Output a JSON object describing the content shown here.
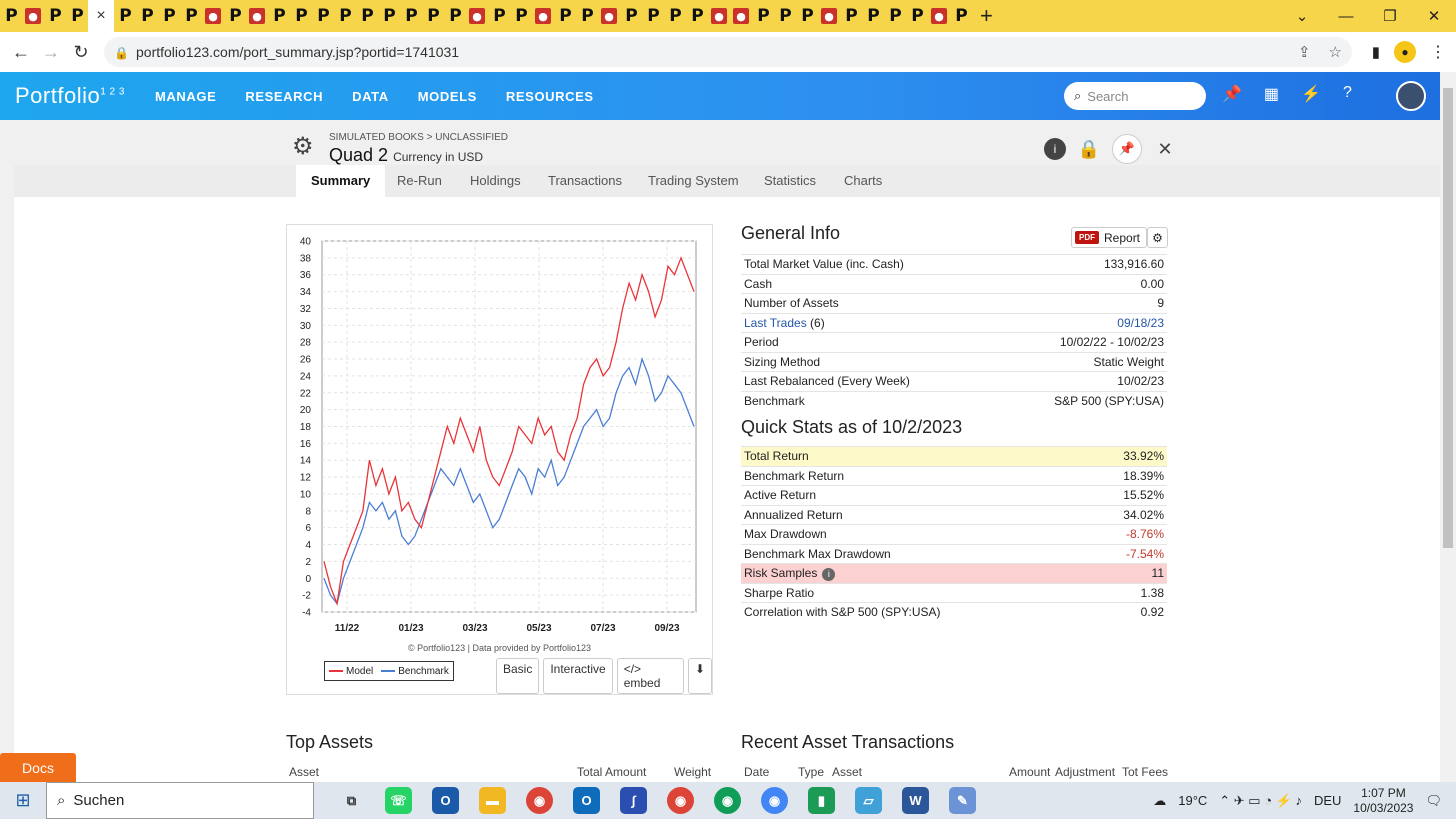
{
  "browser": {
    "active_tab_close": "×",
    "new_tab": "+",
    "url": "portfolio123.com/port_summary.jsp?portid=1741031"
  },
  "site": {
    "logo": "Portfolio",
    "logo_sup": "1 2 3",
    "nav": [
      "MANAGE",
      "RESEARCH",
      "DATA",
      "MODELS",
      "RESOURCES"
    ],
    "search_placeholder": "Search"
  },
  "portfolio": {
    "breadcrumb": "SIMULATED BOOKS > UNCLASSIFIED",
    "name": "Quad 2",
    "currency": "Currency in USD"
  },
  "subtabs": [
    "Summary",
    "Re-Run",
    "Holdings",
    "Transactions",
    "Trading System",
    "Statistics",
    "Charts"
  ],
  "general_info": {
    "title": "General Info",
    "report_pdf": "PDF",
    "report_label": "Report",
    "rows": [
      {
        "label": "Total Market Value (inc. Cash)",
        "value": "133,916.60"
      },
      {
        "label": "Cash",
        "value": "0.00"
      },
      {
        "label": "Number of Assets",
        "value": "9"
      },
      {
        "label": "Last Trades",
        "label_extra": " (6)",
        "value": "09/18/23",
        "link": true
      },
      {
        "label": "Period",
        "value": "10/02/22 - 10/02/23"
      },
      {
        "label": "Sizing Method",
        "value": "Static Weight"
      },
      {
        "label": "Last Rebalanced (Every Week)",
        "value": "10/02/23"
      },
      {
        "label": "Benchmark",
        "value": "S&P 500 (SPY:USA)"
      }
    ]
  },
  "quick_stats": {
    "title": "Quick Stats as of 10/2/2023",
    "rows": [
      {
        "label": "Total Return",
        "value": "33.92%",
        "hl": "y"
      },
      {
        "label": "Benchmark Return",
        "value": "18.39%"
      },
      {
        "label": "Active Return",
        "value": "15.52%"
      },
      {
        "label": "Annualized Return",
        "value": "34.02%"
      },
      {
        "label": "Max Drawdown",
        "value": "-8.76%",
        "neg": true
      },
      {
        "label": "Benchmark Max Drawdown",
        "value": "-7.54%",
        "neg": true
      },
      {
        "label": "Risk Samples",
        "value": "11",
        "hl": "r",
        "info": true
      },
      {
        "label": "Sharpe Ratio",
        "value": "1.38"
      },
      {
        "label": "Correlation with S&P 500 (SPY:USA)",
        "value": "0.92"
      }
    ]
  },
  "chart_data": {
    "type": "line",
    "x_ticks": [
      "11/22",
      "01/23",
      "03/23",
      "05/23",
      "07/23",
      "09/23"
    ],
    "ylim": [
      -4,
      40
    ],
    "y_ticks": [
      40,
      38,
      36,
      34,
      32,
      30,
      28,
      26,
      24,
      22,
      20,
      18,
      16,
      14,
      12,
      10,
      8,
      6,
      4,
      2,
      0,
      -2,
      -4
    ],
    "grid": true,
    "legend": "bottom-left",
    "series": [
      {
        "name": "Model",
        "color": "#e8343a",
        "values": [
          2,
          -1,
          -3,
          2,
          4,
          6,
          8,
          14,
          11,
          13,
          10,
          12,
          8,
          9,
          7,
          6,
          9,
          12,
          15,
          18,
          16,
          19,
          17,
          15,
          18,
          14,
          12,
          11,
          13,
          15,
          18,
          17,
          16,
          19,
          17,
          18,
          15,
          14,
          17,
          19,
          23,
          25,
          26,
          24,
          25,
          28,
          32,
          35,
          33,
          36,
          34,
          31,
          33,
          37,
          36,
          38,
          36,
          34
        ]
      },
      {
        "name": "Benchmark",
        "color": "#4a7ed3",
        "values": [
          0,
          -2,
          -3,
          0,
          2,
          4,
          6,
          9,
          8,
          9,
          7,
          8,
          5,
          4,
          5,
          7,
          9,
          11,
          13,
          12,
          11,
          13,
          11,
          9,
          10,
          8,
          6,
          7,
          9,
          11,
          13,
          12,
          10,
          13,
          12,
          14,
          11,
          12,
          14,
          16,
          18,
          19,
          20,
          18,
          19,
          22,
          24,
          25,
          23,
          26,
          24,
          21,
          22,
          24,
          23,
          22,
          20,
          18
        ]
      }
    ]
  },
  "chart_ui": {
    "credit": "© Portfolio123 | Data provided by Portfolio123",
    "buttons": [
      "Basic",
      "Interactive",
      "</> embed"
    ]
  },
  "lower": {
    "top_assets_title": "Top Assets",
    "recent_tx_title": "Recent Asset Transactions",
    "top_assets_cols": [
      "Asset",
      "Total Amount",
      "Weight"
    ],
    "recent_tx_cols": [
      "Date",
      "Type",
      "Asset",
      "Amount",
      "Adjustment",
      "Tot Fees"
    ]
  },
  "docs_label": "Docs",
  "taskbar": {
    "search": "Suchen",
    "weather": "19°C",
    "lang": "DEU",
    "time": "1:07 PM",
    "date": "10/03/2023"
  }
}
